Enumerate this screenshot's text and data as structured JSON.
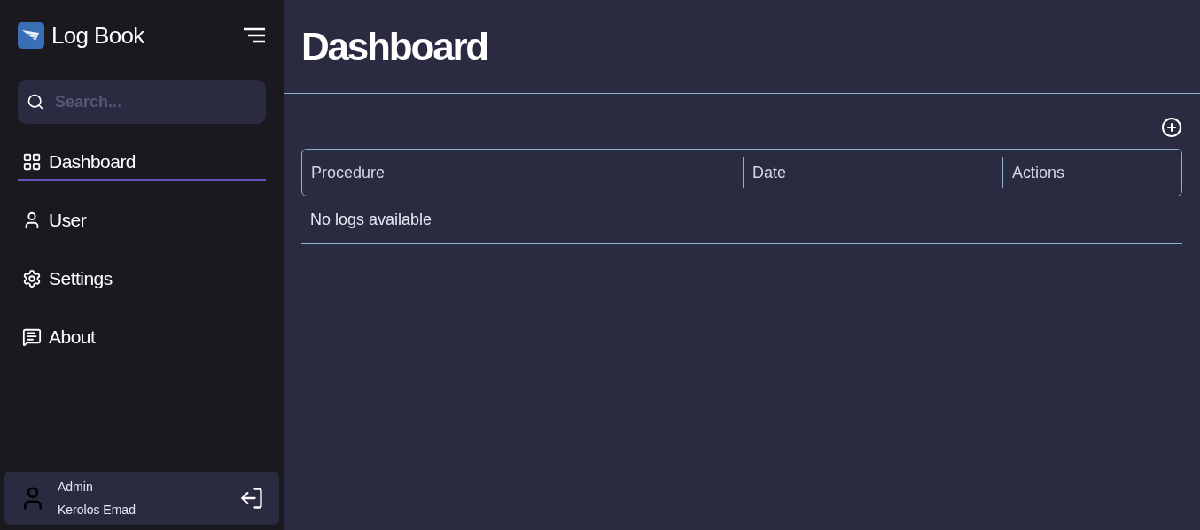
{
  "sidebar": {
    "app_name": "Log Book",
    "search": {
      "placeholder": "Search..."
    },
    "items": [
      {
        "label": "Dashboard",
        "selected": true
      },
      {
        "label": "User",
        "selected": false
      },
      {
        "label": "Settings",
        "selected": false
      },
      {
        "label": "About",
        "selected": false
      }
    ],
    "user": {
      "role": "Admin",
      "name": "Kerolos Emad"
    }
  },
  "main": {
    "title": "Dashboard",
    "table": {
      "columns": [
        "Procedure",
        "Date",
        "Actions"
      ],
      "empty_message": "No logs available"
    }
  }
}
